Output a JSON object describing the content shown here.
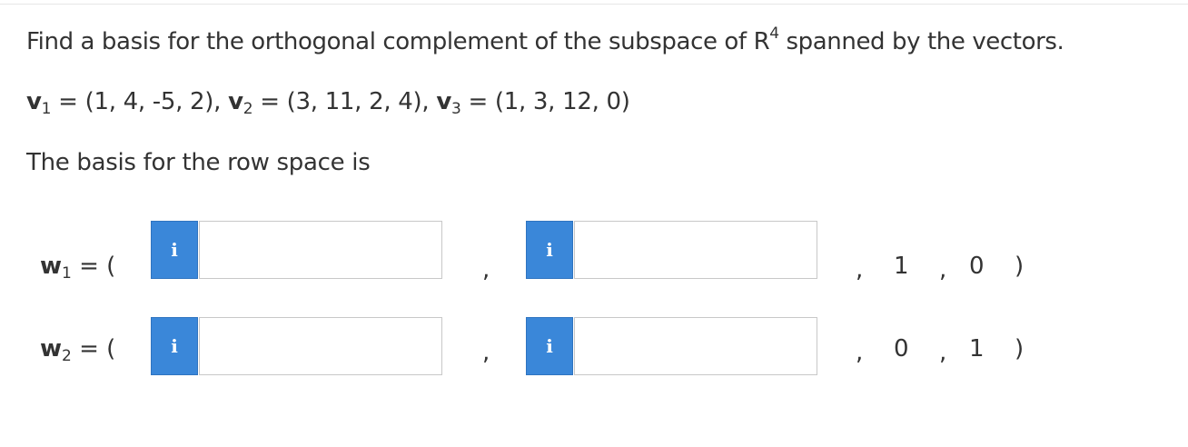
{
  "question": {
    "prompt_before_sup": "Find a basis for the orthogonal complement of the subspace of ",
    "space_symbol": "R",
    "space_exponent": "4",
    "prompt_after_sup": " spanned by the vectors.",
    "vectors": [
      {
        "name": "v",
        "index": "1",
        "value": " = (1, 4, -5, 2)",
        "separator": ", "
      },
      {
        "name": "v",
        "index": "2",
        "value": " = (3, 11, 2, 4)",
        "separator": ", "
      },
      {
        "name": "v",
        "index": "3",
        "value": " = (1, 3, 12, 0)",
        "separator": ""
      }
    ],
    "basis_label": "The basis for the row space is"
  },
  "rows": [
    {
      "name": "w",
      "index": "1",
      "open": " = (",
      "info_icon_label": "i",
      "input_1_value": "",
      "input_2_value": "",
      "comma_1": ",",
      "comma_2": ",",
      "comma_3": ",",
      "fixed_3": "1",
      "fixed_4": "0",
      "close": ")"
    },
    {
      "name": "w",
      "index": "2",
      "open": " = (",
      "info_icon_label": "i",
      "input_1_value": "",
      "input_2_value": "",
      "comma_1": ",",
      "comma_2": ",",
      "comma_3": ",",
      "fixed_3": "0",
      "fixed_4": "1",
      "close": ")"
    }
  ],
  "colors": {
    "text": "#333333",
    "info_button": "#3a87d9",
    "input_border": "#c8c8c8"
  }
}
